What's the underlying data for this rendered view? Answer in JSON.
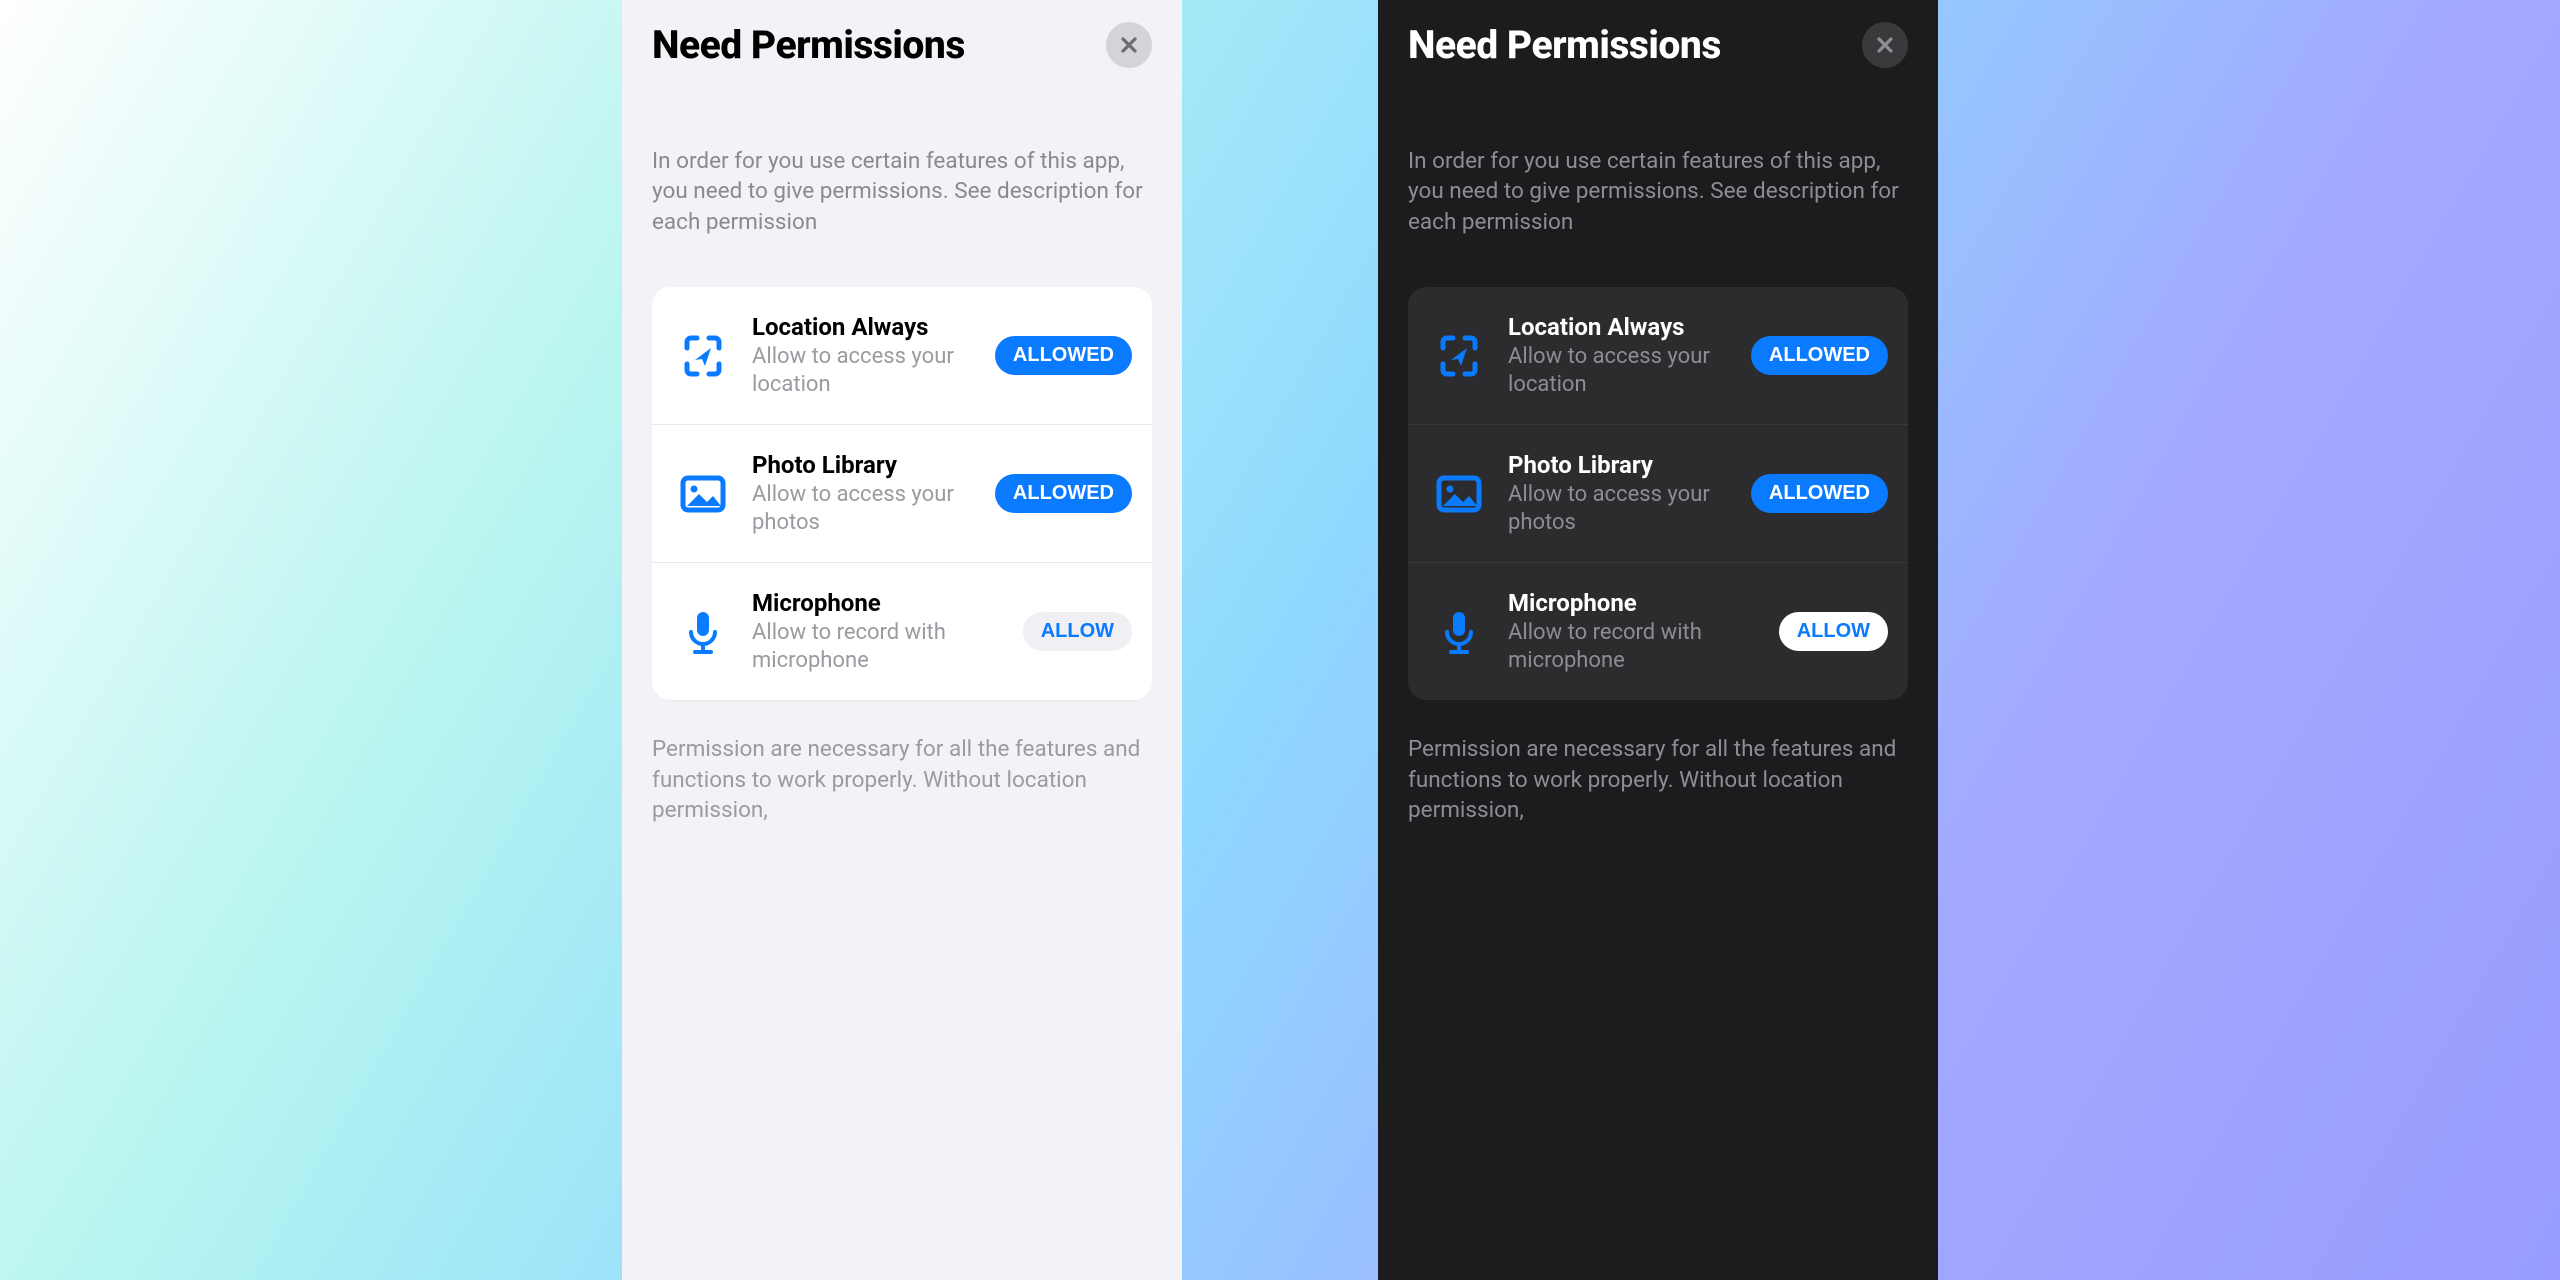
{
  "title": "Need Permissions",
  "subtitle": "In order for you use certain features of this app, you need to give permissions. See description for each permission",
  "buttons": {
    "allowed": "ALLOWED",
    "allow": "ALLOW"
  },
  "permissions": [
    {
      "key": "location",
      "title": "Location Always",
      "desc": "Allow to access your location",
      "state": "allowed",
      "icon": "location-icon"
    },
    {
      "key": "photos",
      "title": "Photo Library",
      "desc": "Allow to access your photos",
      "state": "allowed",
      "icon": "photo-icon"
    },
    {
      "key": "microphone",
      "title": "Microphone",
      "desc": "Allow to record with microphone",
      "state": "allow",
      "icon": "microphone-icon"
    }
  ],
  "footer": "Permission are necessary for all the features and functions to work properly. Without location permission,"
}
